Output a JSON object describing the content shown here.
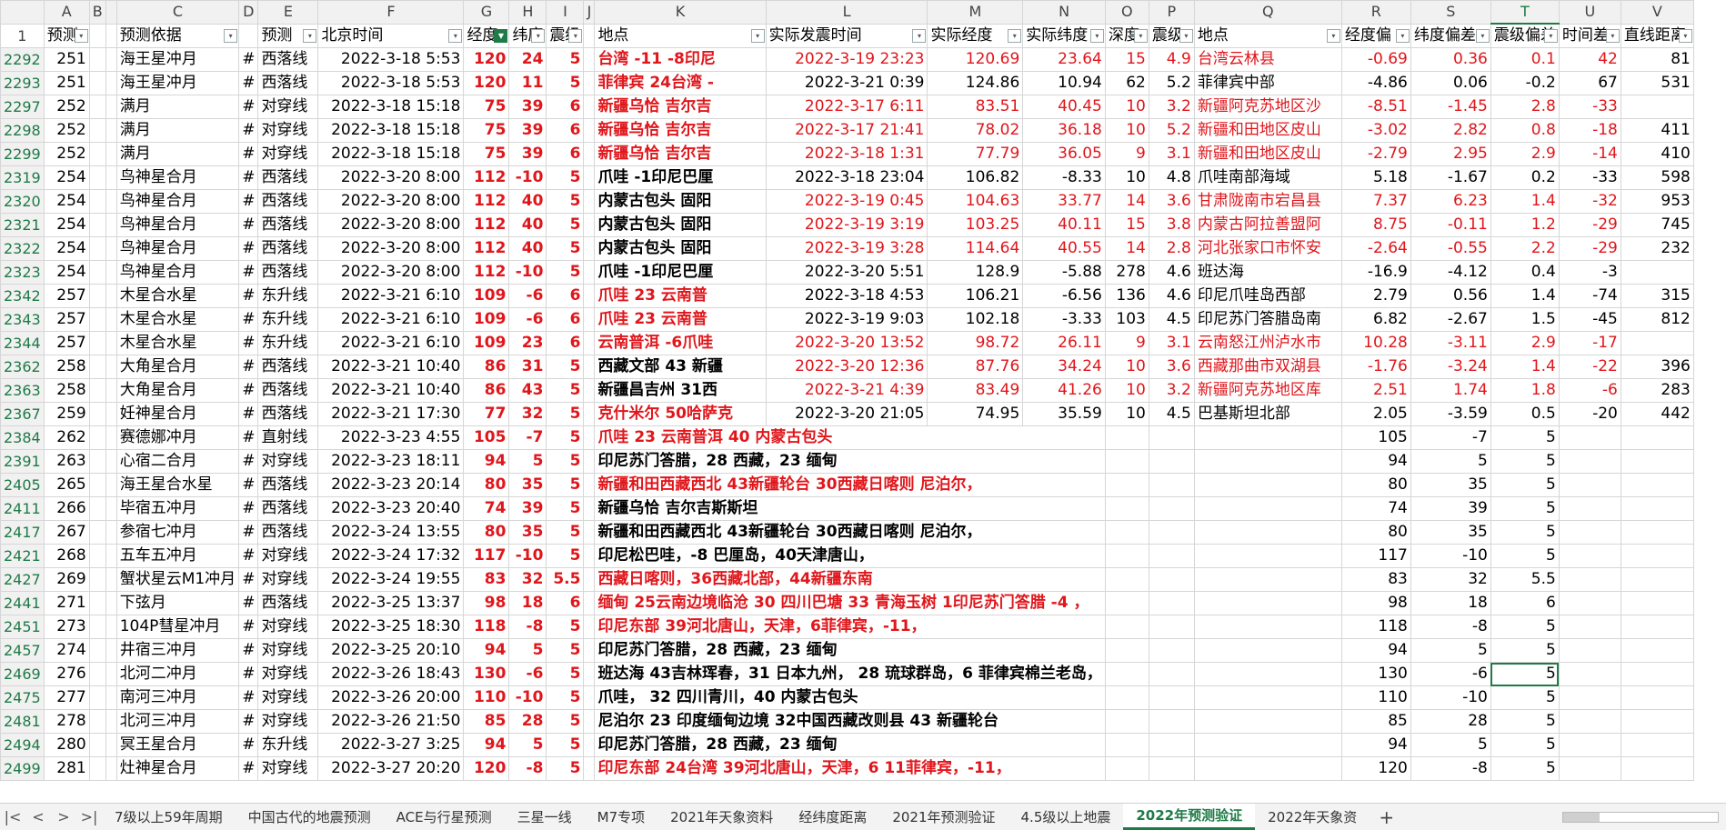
{
  "columns": [
    "A",
    "B",
    "C",
    "D",
    "E",
    "F",
    "G",
    "H",
    "I",
    "J",
    "K",
    "L",
    "M",
    "N",
    "O",
    "P",
    "Q",
    "R",
    "S",
    "T",
    "U",
    "V"
  ],
  "header_row_number": "1",
  "headers": [
    "预测",
    "",
    "预测依据",
    "",
    "预测",
    "北京时间",
    "经度",
    "纬度",
    "震级",
    "",
    "地点",
    "实际发震时间",
    "实际经度",
    "实际纬度",
    "深度",
    "震级",
    "地点",
    "经度偏",
    "纬度偏差",
    "震级偏差",
    "时间差",
    "直线距离"
  ],
  "rows": [
    {
      "n": "2292",
      "a": "251",
      "c": "海王星冲月",
      "d": "#",
      "e": "西落线",
      "f": "2022-3-18 5:53",
      "g": "120",
      "h": "24",
      "i": "5",
      "k": "台湾 -11 -8印尼",
      "kr": true,
      "l": "2022-3-19 23:23",
      "m": "120.69",
      "nn": "23.64",
      "o": "15",
      "p": "4.9",
      "q": "台湾云林县",
      "r": "-0.69",
      "s": "0.36",
      "t": "0.1",
      "u": "42",
      "v": "81",
      "red": true
    },
    {
      "n": "2293",
      "a": "251",
      "c": "海王星冲月",
      "d": "#",
      "e": "西落线",
      "f": "2022-3-18 5:53",
      "g": "120",
      "h": "11",
      "i": "5",
      "k": "菲律宾 24台湾 -",
      "kr": true,
      "l": "2022-3-21 0:39",
      "m": "124.86",
      "nn": "10.94",
      "o": "62",
      "p": "5.2",
      "q": "菲律宾中部",
      "r": "-4.86",
      "s": "0.06",
      "t": "-0.2",
      "u": "67",
      "v": "531",
      "red": false
    },
    {
      "n": "2297",
      "a": "252",
      "c": "满月",
      "d": "#",
      "e": "对穿线",
      "f": "2022-3-18 15:18",
      "g": "75",
      "h": "39",
      "i": "6",
      "k": "新疆乌恰 吉尔吉",
      "kr": true,
      "l": "2022-3-17 6:11",
      "m": "83.51",
      "nn": "40.45",
      "o": "10",
      "p": "3.2",
      "q": "新疆阿克苏地区沙",
      "r": "-8.51",
      "s": "-1.45",
      "t": "2.8",
      "u": "-33",
      "v": "",
      "red": true
    },
    {
      "n": "2298",
      "a": "252",
      "c": "满月",
      "d": "#",
      "e": "对穿线",
      "f": "2022-3-18 15:18",
      "g": "75",
      "h": "39",
      "i": "6",
      "k": "新疆乌恰 吉尔吉",
      "kr": true,
      "l": "2022-3-17 21:41",
      "m": "78.02",
      "nn": "36.18",
      "o": "10",
      "p": "5.2",
      "q": "新疆和田地区皮山",
      "r": "-3.02",
      "s": "2.82",
      "t": "0.8",
      "u": "-18",
      "v": "411",
      "red": true
    },
    {
      "n": "2299",
      "a": "252",
      "c": "满月",
      "d": "#",
      "e": "对穿线",
      "f": "2022-3-18 15:18",
      "g": "75",
      "h": "39",
      "i": "6",
      "k": "新疆乌恰 吉尔吉",
      "kr": true,
      "l": "2022-3-18 1:31",
      "m": "77.79",
      "nn": "36.05",
      "o": "9",
      "p": "3.1",
      "q": "新疆和田地区皮山",
      "r": "-2.79",
      "s": "2.95",
      "t": "2.9",
      "u": "-14",
      "v": "410",
      "red": true
    },
    {
      "n": "2319",
      "a": "254",
      "c": "鸟神星合月",
      "d": "#",
      "e": "西落线",
      "f": "2022-3-20 8:00",
      "g": "112",
      "h": "-10",
      "i": "5",
      "k": "爪哇 -1印尼巴厘",
      "kr": false,
      "l": "2022-3-18 23:04",
      "m": "106.82",
      "nn": "-8.33",
      "o": "10",
      "p": "4.8",
      "q": "爪哇南部海域",
      "r": "5.18",
      "s": "-1.67",
      "t": "0.2",
      "u": "-33",
      "v": "598",
      "red": false
    },
    {
      "n": "2320",
      "a": "254",
      "c": "鸟神星合月",
      "d": "#",
      "e": "西落线",
      "f": "2022-3-20 8:00",
      "g": "112",
      "h": "40",
      "i": "5",
      "k": "内蒙古包头 固阳",
      "kr": false,
      "l": "2022-3-19 0:45",
      "m": "104.63",
      "nn": "33.77",
      "o": "14",
      "p": "3.6",
      "q": "甘肃陇南市宕昌县",
      "r": "7.37",
      "s": "6.23",
      "t": "1.4",
      "u": "-32",
      "v": "953",
      "red": true
    },
    {
      "n": "2321",
      "a": "254",
      "c": "鸟神星合月",
      "d": "#",
      "e": "西落线",
      "f": "2022-3-20 8:00",
      "g": "112",
      "h": "40",
      "i": "5",
      "k": "内蒙古包头 固阳",
      "kr": false,
      "l": "2022-3-19 3:19",
      "m": "103.25",
      "nn": "40.11",
      "o": "15",
      "p": "3.8",
      "q": "内蒙古阿拉善盟阿",
      "r": "8.75",
      "s": "-0.11",
      "t": "1.2",
      "u": "-29",
      "v": "745",
      "red": true
    },
    {
      "n": "2322",
      "a": "254",
      "c": "鸟神星合月",
      "d": "#",
      "e": "西落线",
      "f": "2022-3-20 8:00",
      "g": "112",
      "h": "40",
      "i": "5",
      "k": "内蒙古包头 固阳",
      "kr": false,
      "l": "2022-3-19 3:28",
      "m": "114.64",
      "nn": "40.55",
      "o": "14",
      "p": "2.8",
      "q": "河北张家口市怀安",
      "r": "-2.64",
      "s": "-0.55",
      "t": "2.2",
      "u": "-29",
      "v": "232",
      "red": true
    },
    {
      "n": "2323",
      "a": "254",
      "c": "鸟神星合月",
      "d": "#",
      "e": "西落线",
      "f": "2022-3-20 8:00",
      "g": "112",
      "h": "-10",
      "i": "5",
      "k": "爪哇 -1印尼巴厘",
      "kr": false,
      "l": "2022-3-20 5:51",
      "m": "128.9",
      "nn": "-5.88",
      "o": "278",
      "p": "4.6",
      "q": "班达海",
      "r": "-16.9",
      "s": "-4.12",
      "t": "0.4",
      "u": "-3",
      "v": "",
      "red": false
    },
    {
      "n": "2342",
      "a": "257",
      "c": "木星合水星",
      "d": "#",
      "e": "东升线",
      "f": "2022-3-21 6:10",
      "g": "109",
      "h": "-6",
      "i": "6",
      "k": "爪哇 23 云南普",
      "kr": true,
      "l": "2022-3-18 4:53",
      "m": "106.21",
      "nn": "-6.56",
      "o": "136",
      "p": "4.6",
      "q": "印尼爪哇岛西部",
      "r": "2.79",
      "s": "0.56",
      "t": "1.4",
      "u": "-74",
      "v": "315",
      "red": false
    },
    {
      "n": "2343",
      "a": "257",
      "c": "木星合水星",
      "d": "#",
      "e": "东升线",
      "f": "2022-3-21 6:10",
      "g": "109",
      "h": "-6",
      "i": "6",
      "k": "爪哇 23 云南普",
      "kr": true,
      "l": "2022-3-19 9:03",
      "m": "102.18",
      "nn": "-3.33",
      "o": "103",
      "p": "4.5",
      "q": "印尼苏门答腊岛南",
      "r": "6.82",
      "s": "-2.67",
      "t": "1.5",
      "u": "-45",
      "v": "812",
      "red": false
    },
    {
      "n": "2344",
      "a": "257",
      "c": "木星合水星",
      "d": "#",
      "e": "东升线",
      "f": "2022-3-21 6:10",
      "g": "109",
      "h": "23",
      "i": "6",
      "k": "云南普洱 -6爪哇",
      "kr": true,
      "l": "2022-3-20 13:52",
      "m": "98.72",
      "nn": "26.11",
      "o": "9",
      "p": "3.1",
      "q": "云南怒江州泸水市",
      "r": "10.28",
      "s": "-3.11",
      "t": "2.9",
      "u": "-17",
      "v": "",
      "red": true
    },
    {
      "n": "2362",
      "a": "258",
      "c": "大角星合月",
      "d": "#",
      "e": "西落线",
      "f": "2022-3-21 10:40",
      "g": "86",
      "h": "31",
      "i": "5",
      "k": "西藏文部 43 新疆",
      "kr": false,
      "l": "2022-3-20 12:36",
      "m": "87.76",
      "nn": "34.24",
      "o": "10",
      "p": "3.6",
      "q": "西藏那曲市双湖县",
      "r": "-1.76",
      "s": "-3.24",
      "t": "1.4",
      "u": "-22",
      "v": "396",
      "red": true
    },
    {
      "n": "2363",
      "a": "258",
      "c": "大角星合月",
      "d": "#",
      "e": "西落线",
      "f": "2022-3-21 10:40",
      "g": "86",
      "h": "43",
      "i": "5",
      "k": "新疆昌吉州 31西",
      "kr": false,
      "l": "2022-3-21 4:39",
      "m": "83.49",
      "nn": "41.26",
      "o": "10",
      "p": "3.2",
      "q": "新疆阿克苏地区库",
      "r": "2.51",
      "s": "1.74",
      "t": "1.8",
      "u": "-6",
      "v": "283",
      "red": true
    },
    {
      "n": "2367",
      "a": "259",
      "c": "妊神星合月",
      "d": "#",
      "e": "西落线",
      "f": "2022-3-21 17:30",
      "g": "77",
      "h": "32",
      "i": "5",
      "k": "克什米尔 50哈萨克",
      "kr": true,
      "l": "2022-3-20 21:05",
      "m": "74.95",
      "nn": "35.59",
      "o": "10",
      "p": "4.5",
      "q": "巴基斯坦北部",
      "r": "2.05",
      "s": "-3.59",
      "t": "0.5",
      "u": "-20",
      "v": "442",
      "red": false
    },
    {
      "n": "2384",
      "a": "262",
      "c": "赛德娜冲月",
      "d": "#",
      "e": "直射线",
      "f": "2022-3-23 4:55",
      "g": "105",
      "h": "-7",
      "i": "5",
      "k": "爪哇 23 云南普洱 40 内蒙古包头",
      "kr": true,
      "l": "",
      "m": "",
      "nn": "",
      "o": "",
      "p": "",
      "q": "",
      "r": "105",
      "s": "-7",
      "t": "5",
      "u": "",
      "v": "",
      "red": false
    },
    {
      "n": "2391",
      "a": "263",
      "c": "心宿二合月",
      "d": "#",
      "e": "对穿线",
      "f": "2022-3-23 18:11",
      "g": "94",
      "h": "5",
      "i": "5",
      "k": "印尼苏门答腊，28 西藏，23 缅甸",
      "kr": false,
      "l": "",
      "m": "",
      "nn": "",
      "o": "",
      "p": "",
      "q": "",
      "r": "94",
      "s": "5",
      "t": "5",
      "u": "",
      "v": "",
      "red": false
    },
    {
      "n": "2405",
      "a": "265",
      "c": "海王星合水星",
      "d": "#",
      "e": "西落线",
      "f": "2022-3-23 20:14",
      "g": "80",
      "h": "35",
      "i": "5",
      "k": "新疆和田西藏西北 43新疆轮台 30西藏日喀则 尼泊尔，",
      "kr": true,
      "l": "",
      "m": "",
      "nn": "",
      "o": "",
      "p": "",
      "q": "",
      "r": "80",
      "s": "35",
      "t": "5",
      "u": "",
      "v": "",
      "red": false
    },
    {
      "n": "2411",
      "a": "266",
      "c": "毕宿五冲月",
      "d": "#",
      "e": "西落线",
      "f": "2022-3-23 20:40",
      "g": "74",
      "h": "39",
      "i": "5",
      "k": "新疆乌恰 吉尔吉斯斯坦",
      "kr": false,
      "l": "",
      "m": "",
      "nn": "",
      "o": "",
      "p": "",
      "q": "",
      "r": "74",
      "s": "39",
      "t": "5",
      "u": "",
      "v": "",
      "red": false
    },
    {
      "n": "2417",
      "a": "267",
      "c": "参宿七冲月",
      "d": "#",
      "e": "西落线",
      "f": "2022-3-24 13:55",
      "g": "80",
      "h": "35",
      "i": "5",
      "k": "新疆和田西藏西北 43新疆轮台 30西藏日喀则 尼泊尔，",
      "kr": false,
      "l": "",
      "m": "",
      "nn": "",
      "o": "",
      "p": "",
      "q": "",
      "r": "80",
      "s": "35",
      "t": "5",
      "u": "",
      "v": "",
      "red": false
    },
    {
      "n": "2421",
      "a": "268",
      "c": "五车五冲月",
      "d": "#",
      "e": "对穿线",
      "f": "2022-3-24 17:32",
      "g": "117",
      "h": "-10",
      "i": "5",
      "k": "印尼松巴哇，-8 巴厘岛，40天津唐山，",
      "kr": false,
      "l": "",
      "m": "",
      "nn": "",
      "o": "",
      "p": "",
      "q": "",
      "r": "117",
      "s": "-10",
      "t": "5",
      "u": "",
      "v": "",
      "red": false
    },
    {
      "n": "2427",
      "a": "269",
      "c": "蟹状星云M1冲月",
      "d": "#",
      "e": "对穿线",
      "f": "2022-3-24 19:55",
      "g": "83",
      "h": "32",
      "i": "5.5",
      "k": "西藏日喀则，36西藏北部，44新疆东南",
      "kr": true,
      "l": "",
      "m": "",
      "nn": "",
      "o": "",
      "p": "",
      "q": "",
      "r": "83",
      "s": "32",
      "t": "5.5",
      "u": "",
      "v": "",
      "red": false
    },
    {
      "n": "2441",
      "a": "271",
      "c": "下弦月",
      "d": "#",
      "e": "西落线",
      "f": "2022-3-25 13:37",
      "g": "98",
      "h": "18",
      "i": "6",
      "k": "缅甸 25云南边境临沧 30 四川巴塘 33 青海玉树 1印尼苏门答腊 -4 ，",
      "kr": true,
      "l": "",
      "m": "",
      "nn": "",
      "o": "",
      "p": "",
      "q": "",
      "r": "98",
      "s": "18",
      "t": "6",
      "u": "",
      "v": "",
      "red": false
    },
    {
      "n": "2451",
      "a": "273",
      "c": "104P彗星冲月",
      "d": "#",
      "e": "对穿线",
      "f": "2022-3-25 18:30",
      "g": "118",
      "h": "-8",
      "i": "5",
      "k": "印尼东部 39河北唐山，天津，6菲律宾，-11，",
      "kr": true,
      "l": "",
      "m": "",
      "nn": "",
      "o": "",
      "p": "",
      "q": "",
      "r": "118",
      "s": "-8",
      "t": "5",
      "u": "",
      "v": "",
      "red": false
    },
    {
      "n": "2457",
      "a": "274",
      "c": "井宿三冲月",
      "d": "#",
      "e": "对穿线",
      "f": "2022-3-25 20:10",
      "g": "94",
      "h": "5",
      "i": "5",
      "k": "印尼苏门答腊，28 西藏，23 缅甸",
      "kr": false,
      "l": "",
      "m": "",
      "nn": "",
      "o": "",
      "p": "",
      "q": "",
      "r": "94",
      "s": "5",
      "t": "5",
      "u": "",
      "v": "",
      "red": false
    },
    {
      "n": "2469",
      "a": "276",
      "c": "北河二冲月",
      "d": "#",
      "e": "对穿线",
      "f": "2022-3-26 18:43",
      "g": "130",
      "h": "-6",
      "i": "5",
      "k": "班达海 43吉林珲春，31 日本九州， 28 琉球群岛，6 菲律宾棉兰老岛，",
      "kr": false,
      "l": "",
      "m": "",
      "nn": "",
      "o": "",
      "p": "",
      "q": "",
      "r": "130",
      "s": "-6",
      "t": "5",
      "u": "",
      "v": "",
      "red": false,
      "sel": true
    },
    {
      "n": "2475",
      "a": "277",
      "c": "南河三冲月",
      "d": "#",
      "e": "对穿线",
      "f": "2022-3-26 20:00",
      "g": "110",
      "h": "-10",
      "i": "5",
      "k": "爪哇， 32 四川青川，40 内蒙古包头",
      "kr": false,
      "l": "",
      "m": "",
      "nn": "",
      "o": "",
      "p": "",
      "q": "",
      "r": "110",
      "s": "-10",
      "t": "5",
      "u": "",
      "v": "",
      "red": false
    },
    {
      "n": "2481",
      "a": "278",
      "c": "北河三冲月",
      "d": "#",
      "e": "对穿线",
      "f": "2022-3-26 21:50",
      "g": "85",
      "h": "28",
      "i": "5",
      "k": "尼泊尔 23 印度缅甸边境 32中国西藏改则县 43 新疆轮台",
      "kr": false,
      "l": "",
      "m": "",
      "nn": "",
      "o": "",
      "p": "",
      "q": "",
      "r": "85",
      "s": "28",
      "t": "5",
      "u": "",
      "v": "",
      "red": false
    },
    {
      "n": "2494",
      "a": "280",
      "c": "冥王星合月",
      "d": "#",
      "e": "东升线",
      "f": "2022-3-27 3:25",
      "g": "94",
      "h": "5",
      "i": "5",
      "k": "印尼苏门答腊，28 西藏，23 缅甸",
      "kr": false,
      "l": "",
      "m": "",
      "nn": "",
      "o": "",
      "p": "",
      "q": "",
      "r": "94",
      "s": "5",
      "t": "5",
      "u": "",
      "v": "",
      "red": false
    },
    {
      "n": "2499",
      "a": "281",
      "c": "灶神星合月",
      "d": "#",
      "e": "对穿线",
      "f": "2022-3-27 20:20",
      "g": "120",
      "h": "-8",
      "i": "5",
      "k": "印尼东部 24台湾 39河北唐山，天津，6 11菲律宾，-11，",
      "kr": true,
      "l": "",
      "m": "",
      "nn": "",
      "o": "",
      "p": "",
      "q": "",
      "r": "120",
      "s": "-8",
      "t": "5",
      "u": "",
      "v": "",
      "red": false
    }
  ],
  "sheet_tabs": [
    "7级以上59年周期",
    "中国古代的地震预测",
    "ACE与行星预测",
    "三星一线",
    "M7专项",
    "2021年天象资料",
    "经纬度距离",
    "2021年预测验证",
    "4.5级以上地震",
    "2022年预测验证",
    "2022年天象资"
  ],
  "active_tab": "2022年预测验证",
  "add_sheet_label": "+",
  "nav": {
    "first": "|<",
    "prev": "<",
    "next": ">",
    "last": ">|"
  },
  "colors": {
    "red": "#e0161b",
    "accent": "#1e7a46"
  }
}
